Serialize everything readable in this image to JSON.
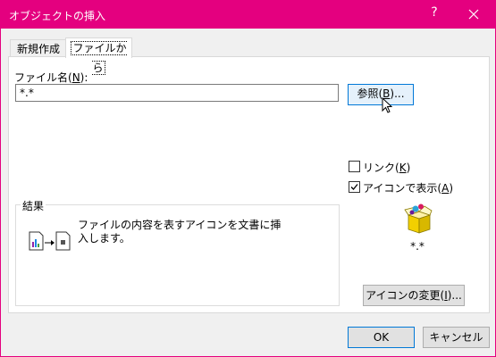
{
  "window": {
    "title": "オブジェクトの挿入",
    "help_glyph": "?"
  },
  "tabs": {
    "new_label": "新規作成",
    "file_label": "ファイルから"
  },
  "file": {
    "label_prefix": "ファイル名(",
    "label_key": "N",
    "label_suffix": "):",
    "value": "*.*"
  },
  "browse": {
    "prefix": "参照(",
    "key": "B",
    "suffix": ")..."
  },
  "options": {
    "link": {
      "prefix": "リンク(",
      "key": "K",
      "suffix": ")",
      "checked": false
    },
    "show_icon": {
      "prefix": "アイコンで表示(",
      "key": "A",
      "suffix": ")",
      "checked": true
    }
  },
  "preview": {
    "caption": "*.*"
  },
  "result": {
    "title": "結果",
    "text": "ファイルの内容を表すアイコンを文書に挿入します。"
  },
  "change_icon": {
    "prefix": "アイコンの変更(",
    "key": "I",
    "suffix": ")..."
  },
  "footer": {
    "ok_label": "OK",
    "cancel_label": "キャンセル"
  },
  "colors": {
    "titlebar": "#e4007f",
    "focus": "#0078d7"
  }
}
